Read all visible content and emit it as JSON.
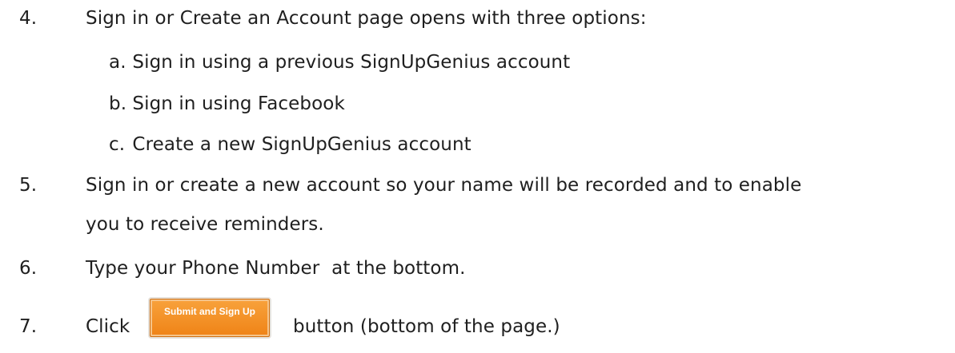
{
  "steps": [
    {
      "number": "4.",
      "text": "Sign in or Create an Account page opens with three options:",
      "options": [
        {
          "letter": "a.",
          "text": "Sign in using a previous SignUpGenius account"
        },
        {
          "letter": "b.",
          "text": "Sign in using Facebook"
        },
        {
          "letter": "c.",
          "text": "Create a new SignUpGenius account"
        }
      ]
    },
    {
      "number": "5.",
      "text_line1": "Sign in or create a new account so your name will be recorded and to enable",
      "text_line2": "you to receive reminders."
    },
    {
      "number": "6.",
      "text": "Type your Phone Number  at the bottom."
    },
    {
      "number": "7.",
      "text_before": "Click",
      "button_label": "Submit and Sign Up",
      "text_after": "button (bottom of the page.)"
    }
  ],
  "colors": {
    "button_bg": "#f28a1e",
    "button_text": "#ffffff",
    "body_text": "#1f1f1f"
  }
}
